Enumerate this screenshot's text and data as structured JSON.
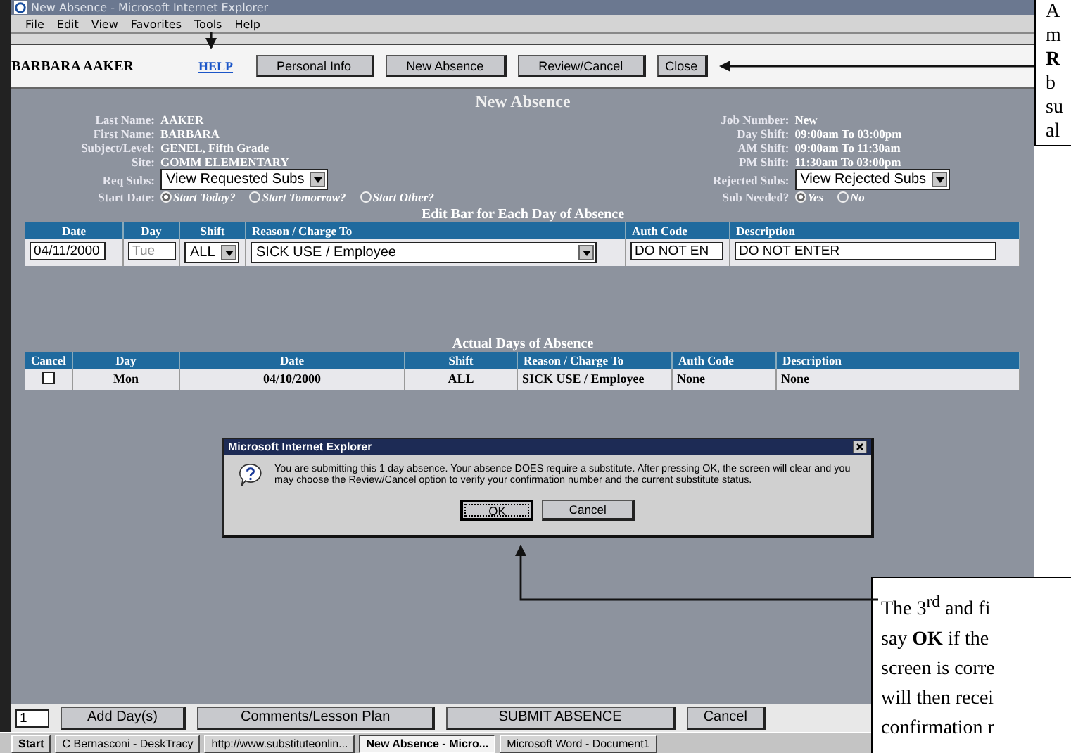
{
  "window": {
    "title": "New Absence - Microsoft Internet Explorer",
    "menu": [
      "File",
      "Edit",
      "View",
      "Favorites",
      "Tools",
      "Help"
    ]
  },
  "toolbar": {
    "user_name": "BARBARA AAKER",
    "help_link": "HELP",
    "buttons": [
      "Personal Info",
      "New Absence",
      "Review/Cancel",
      "Close"
    ]
  },
  "page_title": "New Absence",
  "employee": [
    {
      "label": "Last Name:",
      "value": "AAKER"
    },
    {
      "label": "First Name:",
      "value": "BARBARA"
    },
    {
      "label": "Subject/Level:",
      "value": "GENEL, Fifth Grade"
    },
    {
      "label": "Site:",
      "value": "GOMM ELEMENTARY"
    }
  ],
  "requested_subs": {
    "label": "Req Subs:",
    "value": "View Requested Subs"
  },
  "start_date": {
    "label": "Start Date:",
    "options": [
      {
        "label": "Start Today?",
        "selected": true
      },
      {
        "label": "Start Tomorrow?",
        "selected": false
      },
      {
        "label": "Start Other?",
        "selected": false
      }
    ]
  },
  "job": [
    {
      "label": "Job Number:",
      "value": "New"
    },
    {
      "label": "Day Shift:",
      "value": "09:00am To 03:00pm"
    },
    {
      "label": "AM Shift:",
      "value": "09:00am To 11:30am"
    },
    {
      "label": "PM Shift:",
      "value": "11:30am To 03:00pm"
    }
  ],
  "rejected_subs": {
    "label": "Rejected Subs:",
    "value": "View Rejected Subs"
  },
  "sub_needed": {
    "label": "Sub Needed?",
    "options": [
      {
        "label": "Yes",
        "selected": true
      },
      {
        "label": "No",
        "selected": false
      }
    ]
  },
  "edit_bar": {
    "title": "Edit Bar for Each Day of Absence",
    "columns": [
      "Date",
      "Day",
      "Shift",
      "Reason / Charge To",
      "Auth Code",
      "Description"
    ],
    "row": {
      "date": "04/11/2000",
      "day": {
        "placeholder": "Tue"
      },
      "shift": "ALL",
      "reason": "SICK USE / Employee",
      "auth_code": "DO NOT EN",
      "description": "DO NOT ENTER"
    }
  },
  "actual_days": {
    "title": "Actual Days of Absence",
    "columns": [
      "Cancel",
      "Day",
      "Date",
      "Shift",
      "Reason / Charge To",
      "Auth Code",
      "Description"
    ],
    "rows": [
      {
        "checked": false,
        "day": "Mon",
        "date": "04/10/2000",
        "shift": "ALL",
        "reason": "SICK USE / Employee",
        "auth_code": "None",
        "description": "None"
      }
    ]
  },
  "dialog": {
    "title": "Microsoft Internet Explorer",
    "message": "You are submitting this 1 day absence.  Your absence DOES require a substitute.  After pressing OK, the screen will clear and you may choose the Review/Cancel option to verify your confirmation number and the current substitute status.",
    "buttons": [
      {
        "label": "OK",
        "selected": true
      },
      {
        "label": "Cancel",
        "selected": false
      }
    ]
  },
  "footer": {
    "day_count": "1",
    "buttons": [
      "Add Day(s)",
      "Comments/Lesson Plan",
      "SUBMIT ABSENCE",
      "Cancel"
    ]
  },
  "taskbar": {
    "start": "Start",
    "items": [
      {
        "label": "C Bernasconi - DeskTracy",
        "selected": false
      },
      {
        "label": "http://www.substituteonlin...",
        "selected": false
      },
      {
        "label": "New Absence - Micro...",
        "selected": true
      },
      {
        "label": "Microsoft Word - Document1",
        "selected": false
      }
    ]
  },
  "callouts": [
    {
      "kind": "top",
      "lines": [
        "A",
        "m",
        "**R**",
        "b",
        "su",
        "al"
      ]
    },
    {
      "kind": "bottom",
      "lines": [
        "The 3$^{rd}$ and fi",
        "say **OK** if the",
        "screen is corre",
        "will then recei",
        "confirmation r"
      ]
    }
  ]
}
